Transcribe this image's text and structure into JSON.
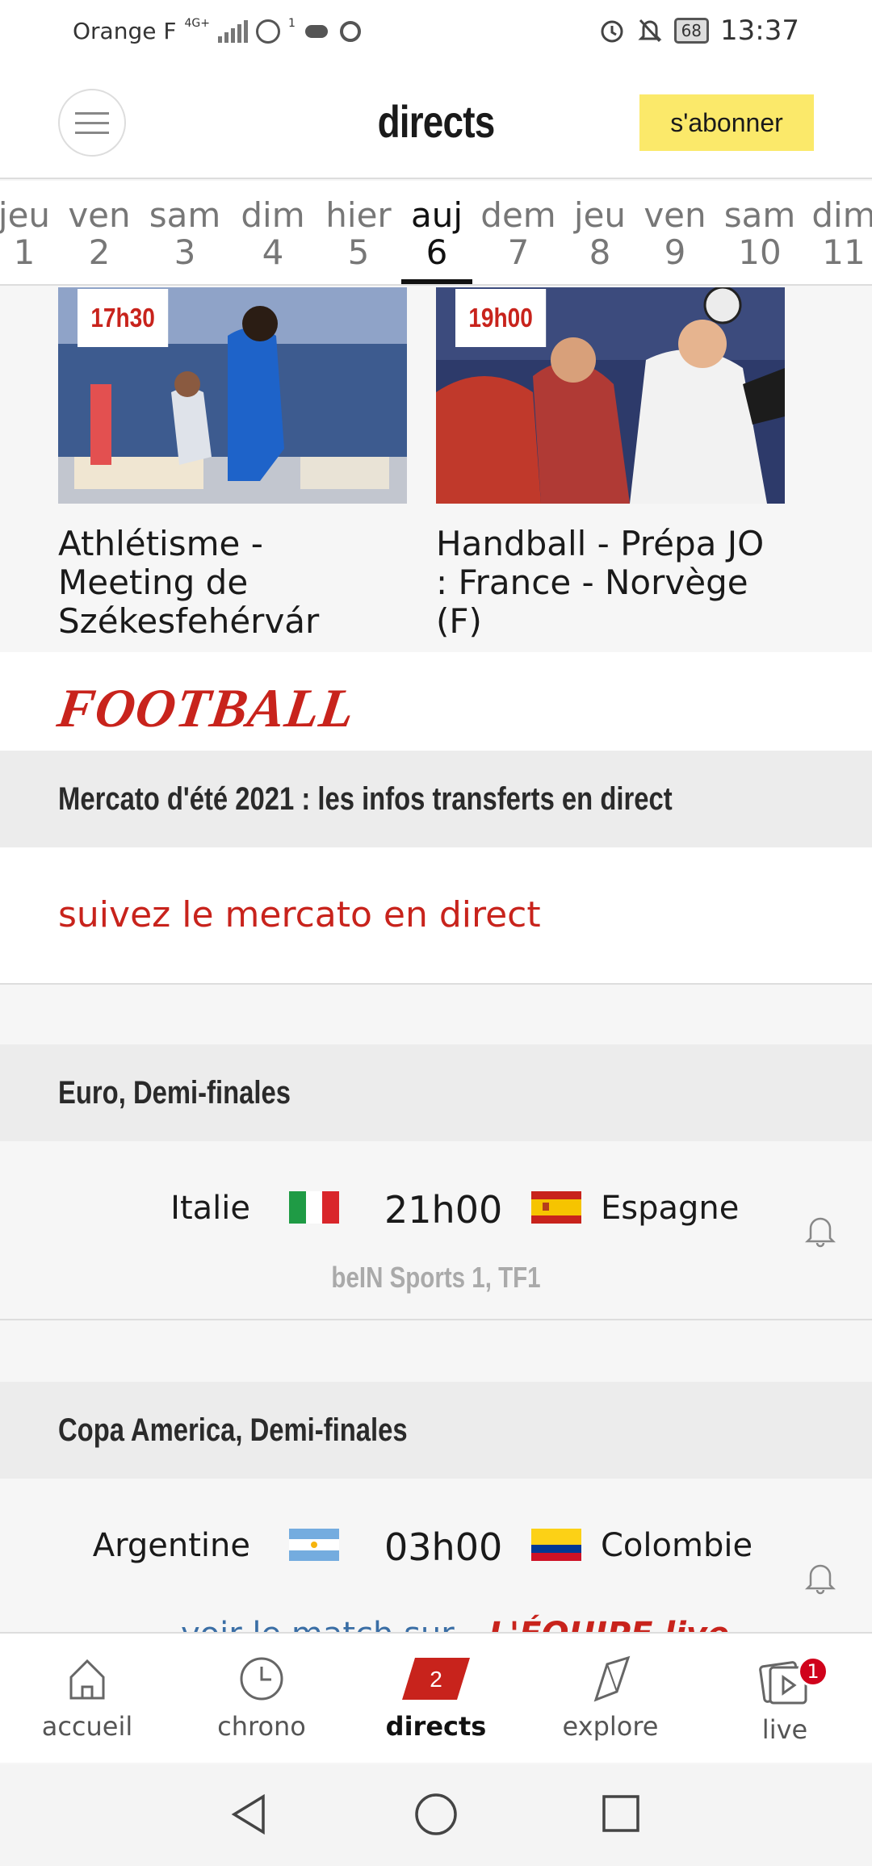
{
  "status_bar": {
    "carrier": "Orange F",
    "network": "4G+",
    "notification_count": "1",
    "battery": "68",
    "time": "13:37",
    "icons": [
      "signal-icon",
      "hotspot-icon",
      "game-icon",
      "app-icon",
      "alarm-icon",
      "mute-icon",
      "battery-icon"
    ]
  },
  "header": {
    "title": "directs",
    "subscribe_label": "s'abonner",
    "menu_icon": "hamburger-icon"
  },
  "day_nav": {
    "days": [
      {
        "name": "jeu",
        "num": "1"
      },
      {
        "name": "ven",
        "num": "2"
      },
      {
        "name": "sam",
        "num": "3"
      },
      {
        "name": "dim",
        "num": "4"
      },
      {
        "name": "hier",
        "num": "5"
      },
      {
        "name": "auj",
        "num": "6"
      },
      {
        "name": "dem",
        "num": "7"
      },
      {
        "name": "jeu",
        "num": "8"
      },
      {
        "name": "ven",
        "num": "9"
      },
      {
        "name": "sam",
        "num": "10"
      },
      {
        "name": "dim",
        "num": "11"
      }
    ],
    "active_index": 5
  },
  "cards": [
    {
      "time": "17h30",
      "title": "Athlétisme - Meeting de Székesfehérvár"
    },
    {
      "time": "19h00",
      "title": "Handball - Prépa JO : France - Norvège (F)"
    }
  ],
  "sport_section": "FOOTBALL",
  "mercato": {
    "heading": "Mercato d'été 2021 : les infos transferts en direct",
    "link": "suivez le mercato en direct"
  },
  "matches": [
    {
      "competition": "Euro, Demi-finales",
      "home": "Italie",
      "away": "Espagne",
      "time": "21h00",
      "tv": "beIN Sports 1, TF1"
    },
    {
      "competition": "Copa America, Demi-finales",
      "home": "Argentine",
      "away": "Colombie",
      "time": "03h00",
      "watch": "voir le match sur",
      "watch_brand": "L'ÉQUIPE live"
    }
  ],
  "bottom_nav": {
    "tabs": [
      {
        "label": "accueil",
        "icon": "home-icon"
      },
      {
        "label": "chrono",
        "icon": "clock-icon"
      },
      {
        "label": "directs",
        "icon": "directs-icon",
        "count": "2"
      },
      {
        "label": "explore",
        "icon": "explore-icon"
      },
      {
        "label": "live",
        "icon": "live-icon",
        "badge": "1"
      }
    ],
    "active_index": 2
  },
  "colors": {
    "accent_red": "#c8231c",
    "subscribe_yellow": "#fbe96a",
    "link_blue": "#3a6ea5"
  }
}
